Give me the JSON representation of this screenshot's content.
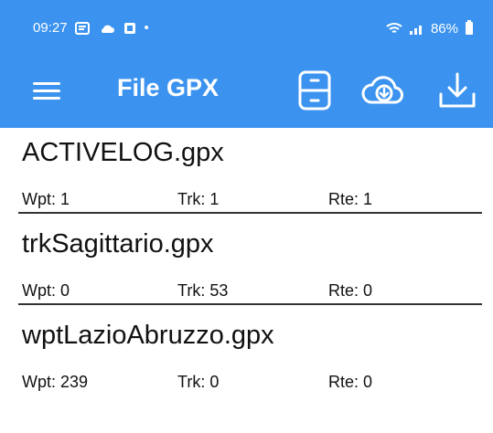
{
  "status_bar": {
    "time": "09:27",
    "dot": "•",
    "battery": "86%"
  },
  "app_bar": {
    "title": "File GPX"
  },
  "files": [
    {
      "name": "ACTIVELOG.gpx",
      "wpt": "Wpt: 1",
      "trk": "Trk: 1",
      "rte": "Rte: 1"
    },
    {
      "name": "trkSagittario.gpx",
      "wpt": "Wpt: 0",
      "trk": "Trk: 53",
      "rte": "Rte: 0"
    },
    {
      "name": "wptLazioAbruzzo.gpx",
      "wpt": "Wpt: 239",
      "trk": "Trk: 0",
      "rte": "Rte: 0"
    }
  ],
  "colors": {
    "primary": "#3b93ef",
    "on_primary": "#ffffff",
    "text": "#111111",
    "divider": "#333333"
  },
  "icons": {
    "status_left": [
      "notification-icon",
      "cloud-status-icon",
      "app-status-icon"
    ],
    "status_right": [
      "wifi-icon",
      "signal-icon",
      "battery-icon"
    ],
    "menu": "menu-icon",
    "save": "save-icon",
    "cloud_download": "cloud-download-icon",
    "download": "download-icon"
  }
}
